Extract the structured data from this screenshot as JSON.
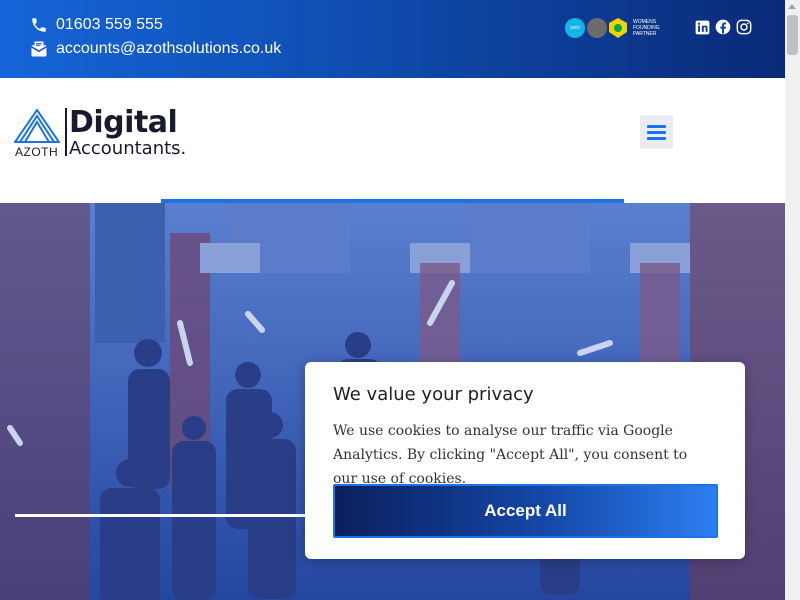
{
  "topbar": {
    "phone": "01603 559 555",
    "email": "accounts@azothsolutions.co.uk",
    "icons": {
      "phone": "phone-icon",
      "email": "email-icon"
    },
    "partners": {
      "xero_text": "xero",
      "platinum_text": "PLATINUM PARTNER",
      "norwich_text": "WOMENS FOUNDING PARTNER"
    },
    "socials": [
      "linkedin-icon",
      "facebook-icon",
      "instagram-icon"
    ],
    "gradient": [
      "#1565d8",
      "#0a2a78"
    ]
  },
  "header": {
    "logo": {
      "azoth": "AZOTH",
      "digital": "Digital",
      "accountants": "Accountants."
    },
    "menu_icon": "hamburger-menu-icon",
    "accent": "#1a73e8"
  },
  "hero": {
    "overlay_color": "#2a4aa8"
  },
  "cookie": {
    "title": "We value your privacy",
    "body": "We use cookies to analyse our traffic via Google Analytics. By clicking \"Accept All\", you consent to our use of cookies.",
    "accept_label": "Accept All"
  }
}
